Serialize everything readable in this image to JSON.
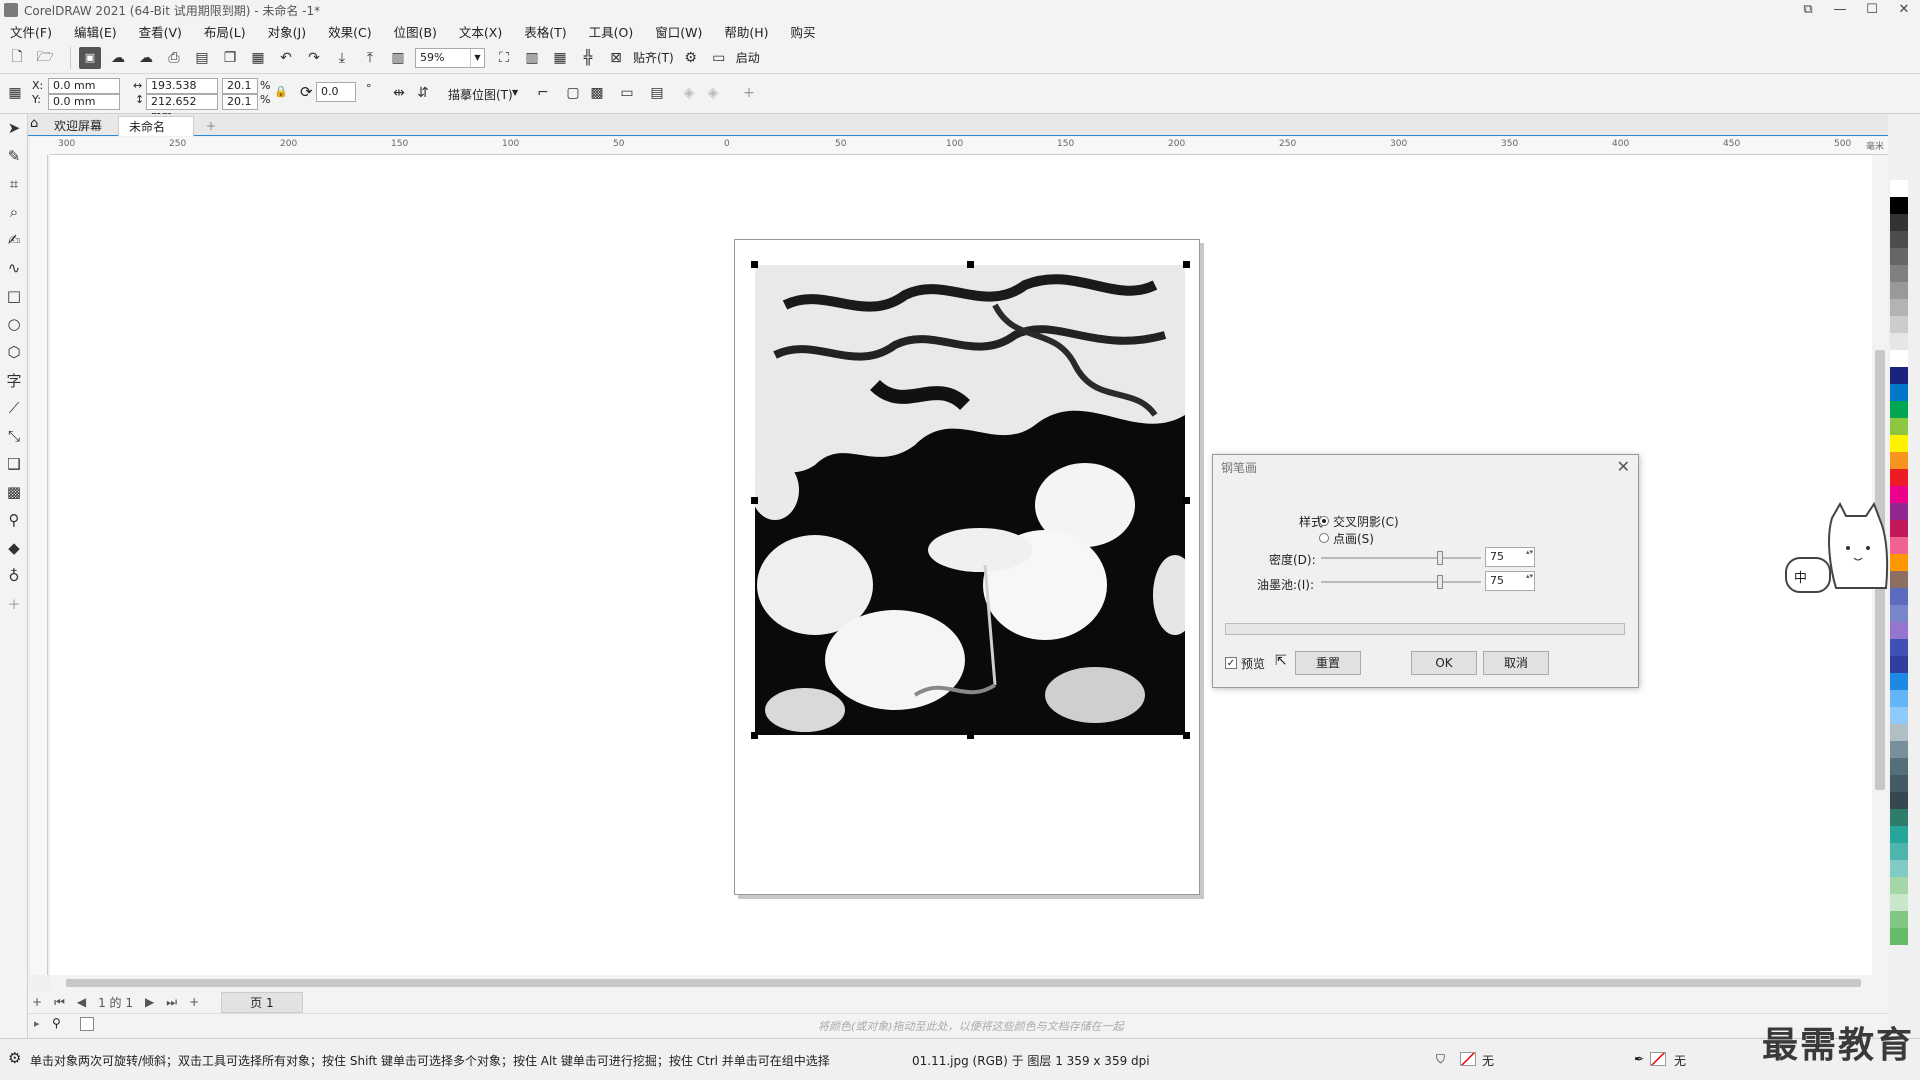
{
  "window": {
    "title": "CorelDRAW 2021 (64-Bit 试用期限到期) - 未命名 -1*",
    "controls": [
      "⧉",
      "—",
      "☐",
      "✕"
    ]
  },
  "menu": [
    "文件(F)",
    "编辑(E)",
    "查看(V)",
    "布局(L)",
    "对象(J)",
    "效果(C)",
    "位图(B)",
    "文本(X)",
    "表格(T)",
    "工具(O)",
    "窗口(W)",
    "帮助(H)",
    "购买"
  ],
  "toolbar": {
    "zoom": "59%",
    "snap_label": "贴齐(T)",
    "launch_label": "启动"
  },
  "propbar": {
    "x_label": "X:",
    "y_label": "Y:",
    "x": "0.0 mm",
    "y": "0.0 mm",
    "width": "193.538 mm",
    "height": "212.652 mm",
    "scale_w": "20.1",
    "scale_h": "20.1",
    "pct": "%",
    "rotation": "0.0",
    "degree": "°",
    "trace_label": "描摹位图(T)"
  },
  "tabs": {
    "welcome": "欢迎屏幕",
    "document": "未命名 -1*",
    "add": "+"
  },
  "ruler_ticks": [
    "300",
    "250",
    "200",
    "150",
    "100",
    "50",
    "0",
    "50",
    "100",
    "150",
    "200",
    "250",
    "300",
    "350",
    "400",
    "450",
    "500"
  ],
  "ruler_unit": "毫米",
  "dialog": {
    "title": "钢笔画",
    "style_label": "样式:",
    "option_cross": "交叉阴影(C)",
    "option_dot": "点画(S)",
    "density_label": "密度(D):",
    "density_value": "75",
    "density_fraction": 0.75,
    "ink_label": "油墨池:(I):",
    "ink_value": "75",
    "ink_fraction": 0.75,
    "preview_label": "预览",
    "reset_label": "重置",
    "ok_label": "OK",
    "cancel_label": "取消"
  },
  "pagenav": {
    "counter": "1 的 1",
    "page_tab": "页 1"
  },
  "color_hint": "将颜色(或对象)拖动至此处，以便将这些颜色与文档存储在一起",
  "status": {
    "hint": "单击对象两次可旋转/倾斜；双击工具可选择所有对象；按住 Shift 键单击可选择多个对象；按住 Alt 键单击可进行挖掘；按住 Ctrl 并单击可在组中选择",
    "object_info": "01.11.jpg (RGB) 于 图层 1 359 x 359 dpi",
    "fill_none": "无",
    "outline_none": "无"
  },
  "mascot_text": "中",
  "watermark": "最需教育",
  "palette": [
    "#ffffff",
    "#000000",
    "#333333",
    "#4d4d4d",
    "#666666",
    "#808080",
    "#999999",
    "#b3b3b3",
    "#cccccc",
    "#e6e6e6",
    "#ffffff",
    "#1a237e",
    "#0077c8",
    "#00a651",
    "#8dc63f",
    "#fff200",
    "#f7941d",
    "#ed1c24",
    "#ec008c",
    "#92278f",
    "#c2185b",
    "#f06292",
    "#ff9800",
    "#8d6e63",
    "#5c6bc0",
    "#7986cb",
    "#9575cd",
    "#3f51b5",
    "#303f9f",
    "#1e88e5",
    "#64b5f6",
    "#90caf9",
    "#b0bec5",
    "#78909c",
    "#546e7a",
    "#455a64",
    "#37474f",
    "#2e7d6b",
    "#26a69a",
    "#4db6ac",
    "#80cbc4",
    "#a5d6a7",
    "#c8e6c9",
    "#81c784",
    "#66bb6a"
  ]
}
